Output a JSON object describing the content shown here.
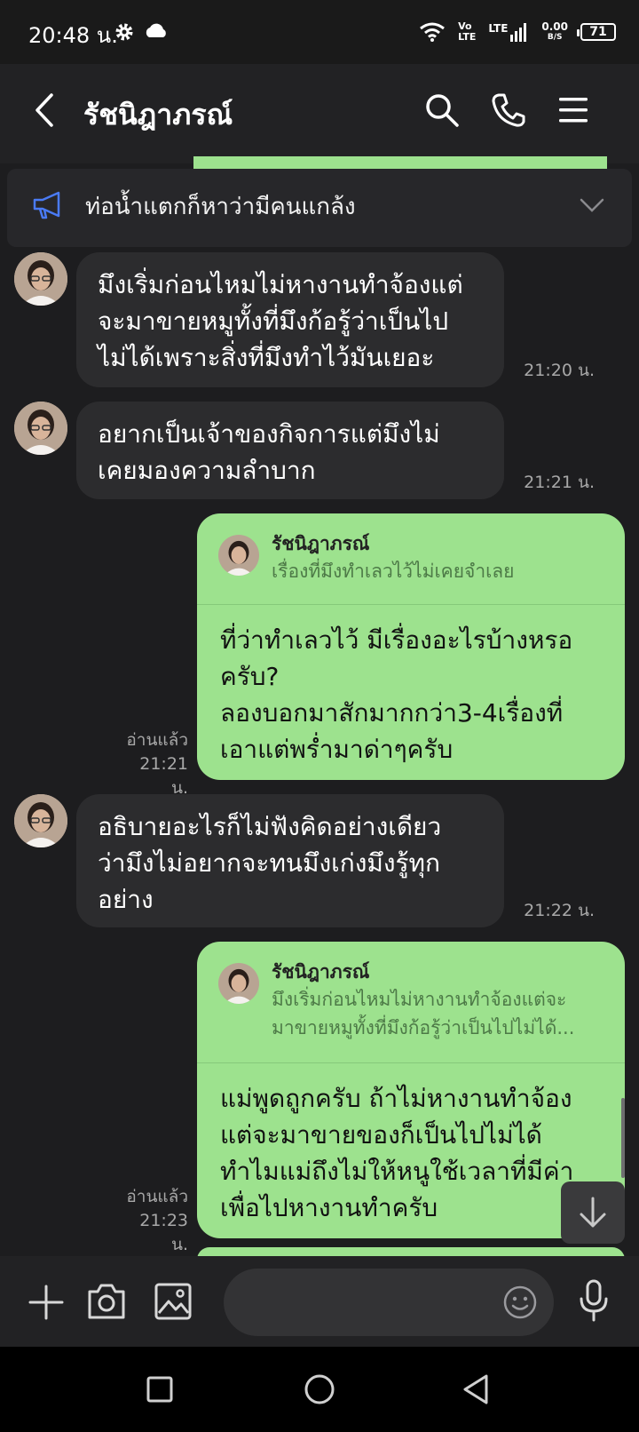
{
  "status_bar": {
    "time": "20:48 น.",
    "net_speed_top": "0.00",
    "net_speed_bottom": "B/S",
    "battery": "71",
    "volte_top": "Vo",
    "volte_bottom": "LTE",
    "lte_label": "LTE"
  },
  "header": {
    "title": "รัชนิฎาภรณ์"
  },
  "announcement": {
    "text": "ท่อน้ำแตกก็หาว่ามีคนแกล้ง"
  },
  "messages": [
    {
      "side": "in",
      "lines": [
        "มึงเริ่มก่อนไหมไม่หางานทำจ้องแต่",
        "จะมาขายหมูทั้งที่มึงก้อรู้ว่าเป็นไป",
        "ไม่ได้เพราะสิ่งที่มึงทำไว้มันเยอะ"
      ],
      "time": "21:20 น."
    },
    {
      "side": "in",
      "lines": [
        "อยากเป็นเจ้าของกิจการแต่มึงไม่",
        "เคยมองความลำบาก"
      ],
      "time": "21:21 น."
    },
    {
      "side": "out",
      "quote_name": "รัชนิฎาภรณ์",
      "quote_lines": [
        "เรื่องที่มึงทำเลวไว้ไม่เคยจำเลย"
      ],
      "lines": [
        "ที่ว่าทำเลวไว้ มีเรื่องอะไรบ้างหรอ",
        "ครับ?",
        "ลองบอกมาสักมากกว่า3-4เรื่องที่",
        "เอาแต่พร่ำมาด่าๆครับ"
      ],
      "read": "อ่านแล้ว",
      "time": "21:21 น."
    },
    {
      "side": "in",
      "lines": [
        "อธิบายอะไรก็ไม่ฟังคิดอย่างเดียว",
        "ว่ามึงไม่อยากจะทนมึงเก่งมึงรู้ทุก",
        "อย่าง"
      ],
      "time": "21:22 น."
    },
    {
      "side": "out",
      "quote_name": "รัชนิฎาภรณ์",
      "quote_lines": [
        "มึงเริ่มก่อนไหมไม่หางานทำจ้องแต่จะ",
        "มาขายหมูทั้งที่มึงก้อรู้ว่าเป็นไปไม่ได้..."
      ],
      "lines": [
        "แม่พูดถูกครับ ถ้าไม่หางานทำจ้อง",
        "แต่จะมาขายของก็เป็นไปไม่ได้",
        "ทำไมแม่ถึงไม่ให้หนูใช้เวลาที่มีค่า",
        "เพื่อไปหางานทำครับ"
      ],
      "read": "อ่านแล้ว",
      "time": "21:23 น."
    }
  ],
  "colors": {
    "outgoing_bubble": "#9de28e",
    "incoming_bubble": "#2c2c2e",
    "background": "#1d1d1f",
    "announce_icon": "#4a7bf5"
  },
  "icons": {
    "back": "back-chevron-icon",
    "search": "search-icon",
    "call": "phone-icon",
    "menu": "menu-icon",
    "announce": "megaphone-icon",
    "expand": "chevron-down-icon",
    "add": "plus-icon",
    "camera": "camera-icon",
    "gallery": "image-icon",
    "emoji": "emoji-icon",
    "mic": "microphone-icon",
    "scroll_down": "arrow-down-icon"
  }
}
